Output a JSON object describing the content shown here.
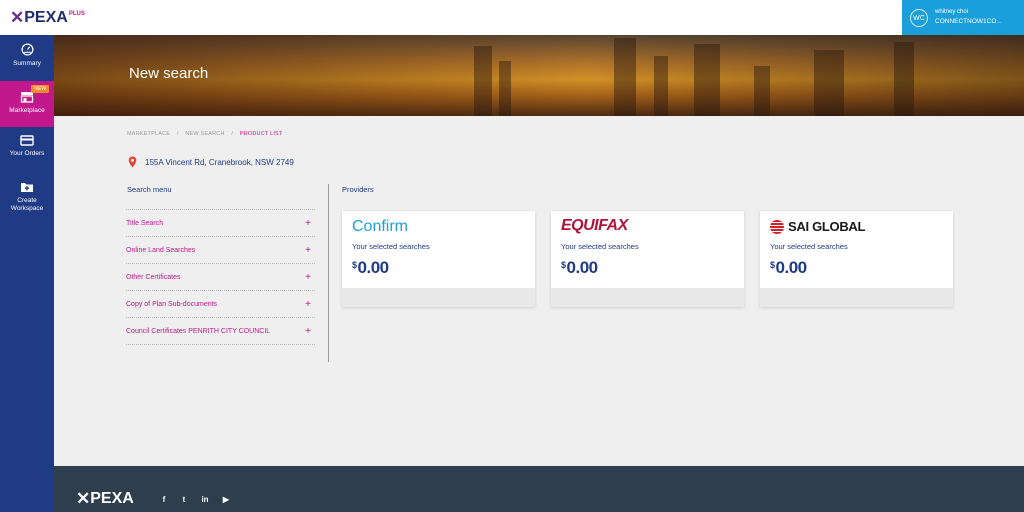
{
  "brand": {
    "name": "PEXA",
    "plus": "PLUS"
  },
  "user": {
    "initials": "WC",
    "name": "whitney choi",
    "org": "CONNECTNOW1CO..."
  },
  "sidebar": {
    "items": [
      {
        "label": "Summary",
        "icon": "dashboard-icon"
      },
      {
        "label": "Marketplace",
        "icon": "store-icon",
        "badge": "NEW",
        "active": true
      },
      {
        "label": "Your Orders",
        "icon": "card-icon"
      },
      {
        "label": "Create Workspace",
        "icon": "folder-plus-icon"
      }
    ]
  },
  "hero": {
    "title": "New search"
  },
  "breadcrumb": {
    "items": [
      "MARKETPLACE",
      "NEW SEARCH",
      "PRODUCT LIST"
    ],
    "sep": "/"
  },
  "address": "155A Vincent Rd, Cranebrook, NSW 2749",
  "search_menu": {
    "title": "Search menu",
    "items": [
      "Title Search",
      "Online Land Searches",
      "Other Certificates",
      "Copy of Plan Sub-documents",
      "Council Certificates PENRITH CITY COUNCIL"
    ],
    "expand_symbol": "+"
  },
  "providers": {
    "title": "Providers",
    "cards": [
      {
        "brand": "Confirm",
        "subtitle": "Your selected searches",
        "currency": "$",
        "amount": "0.00"
      },
      {
        "brand": "EQUIFAX",
        "subtitle": "Your selected searches",
        "currency": "$",
        "amount": "0.00"
      },
      {
        "brand": "SAI GLOBAL",
        "subtitle": "Your selected searches",
        "currency": "$",
        "amount": "0.00"
      }
    ]
  },
  "footer": {
    "brand": "PEXA",
    "social": [
      "f",
      "t",
      "in",
      "▶"
    ]
  },
  "colors": {
    "navy": "#1f3b86",
    "magenta": "#c2188b",
    "blue": "#1a9fdb",
    "footer": "#2e3e4c"
  }
}
